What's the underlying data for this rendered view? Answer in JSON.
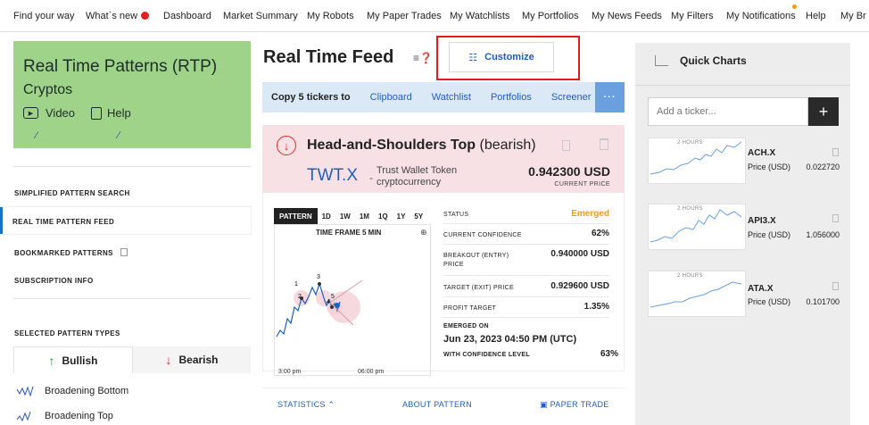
{
  "topnav": {
    "items": [
      "Find your way",
      "What`s new",
      "Dashboard",
      "Market Summary",
      "My Robots",
      "My Paper Trades",
      "My Watchlists",
      "My Portfolios",
      "My News Feeds",
      "My Filters",
      "My Notifications",
      "Help",
      "My Br"
    ]
  },
  "left": {
    "card_title": "Real Time Patterns (RTP)",
    "card_subtitle": "Cryptos",
    "video_label": "Video",
    "help_label": "Help",
    "nav": [
      "SIMPLIFIED PATTERN SEARCH",
      "REAL TIME PATTERN FEED",
      "BOOKMARKED PATTERNS",
      "SUBSCRIPTION INFO"
    ],
    "selected_types_heading": "SELECTED PATTERN TYPES",
    "bullish_label": "Bullish",
    "bearish_label": "Bearish",
    "pattern_types": [
      "Broadening Bottom",
      "Broadening Top"
    ]
  },
  "feed": {
    "title": "Real Time Feed",
    "customize_label": "Customize",
    "copy_label": "Copy 5 tickers to",
    "copy_links": [
      "Clipboard",
      "Watchlist",
      "Portfolios",
      "Screener"
    ],
    "more_label": "···"
  },
  "pattern": {
    "name": "Head-and-Shoulders Top",
    "type": "(bearish)",
    "ticker": "TWT.X",
    "ticker_name_1": "Trust Wallet Token",
    "ticker_name_2": "cryptocurrency",
    "price": "0.942300 USD",
    "price_label": "CURRENT PRICE",
    "timeframe_tabs": [
      "PATTERN",
      "1D",
      "1W",
      "1M",
      "1Q",
      "1Y",
      "5Y"
    ],
    "active_tab": "PATTERN",
    "chart_title": "TIME FRAME 5 MIN",
    "x_labels": [
      "3:00 pm",
      "06:00 pm"
    ],
    "point_labels": [
      "1",
      "2",
      "3",
      "4",
      "5"
    ],
    "stats": {
      "status_label": "STATUS",
      "status_value": "Emerged",
      "status_color": "#f39c12",
      "confidence_label": "CURRENT CONFIDENCE",
      "confidence_value": "62%",
      "breakout_label_1": "BREAKOUT (ENTRY)",
      "breakout_label_2": "PRICE",
      "breakout_value": "0.940000 USD",
      "target_label": "TARGET (EXIT) PRICE",
      "target_value": "0.929600 USD",
      "profit_label": "PROFIT TARGET",
      "profit_value": "1.35%",
      "emerged_label": "EMERGED ON",
      "emerged_value": "Jun 23, 2023 04:50 PM (UTC)",
      "with_conf_label": "WITH CONFIDENCE LEVEL",
      "with_conf_value": "63%"
    },
    "footer": {
      "statistics": "STATISTICS",
      "about": "ABOUT PATTERN",
      "paper_trade": "PAPER TRADE"
    }
  },
  "quick_charts": {
    "title": "Quick Charts",
    "input_placeholder": "Add a ticker...",
    "add_label": "+",
    "hours_label": "2 HOURS",
    "price_label": "Price (USD)",
    "items": [
      {
        "ticker": "ACH.X",
        "price": "0.022720"
      },
      {
        "ticker": "API3.X",
        "price": "1.056000"
      },
      {
        "ticker": "ATA.X",
        "price": "0.101700"
      }
    ]
  }
}
